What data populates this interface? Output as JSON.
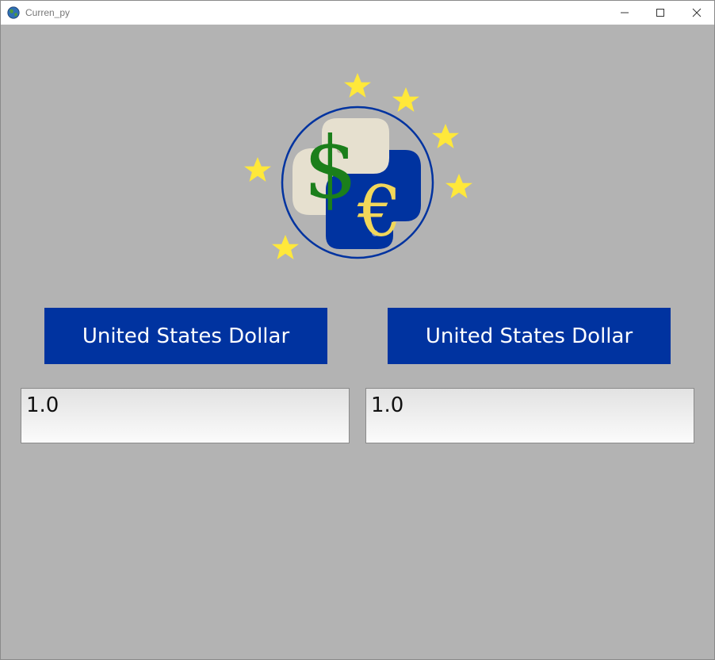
{
  "window": {
    "title": "Curren_py"
  },
  "logo": {
    "dollar_symbol": "$",
    "euro_symbol": "€",
    "icon": "python-currency-logo-icon",
    "colors": {
      "star": "#ffe83a",
      "dollar": "#1b7f1b",
      "euro": "#f2d75a",
      "ring": "#0033a0",
      "python_light": "#e6e0cf",
      "python_dark": "#0033a0"
    }
  },
  "converter": {
    "from_currency_label": "United States Dollar",
    "to_currency_label": "United States Dollar",
    "from_amount": "1.0",
    "to_amount": "1.0"
  },
  "colors": {
    "background": "#b3b3b3",
    "button": "#0033a0",
    "button_text": "#ffffff"
  }
}
